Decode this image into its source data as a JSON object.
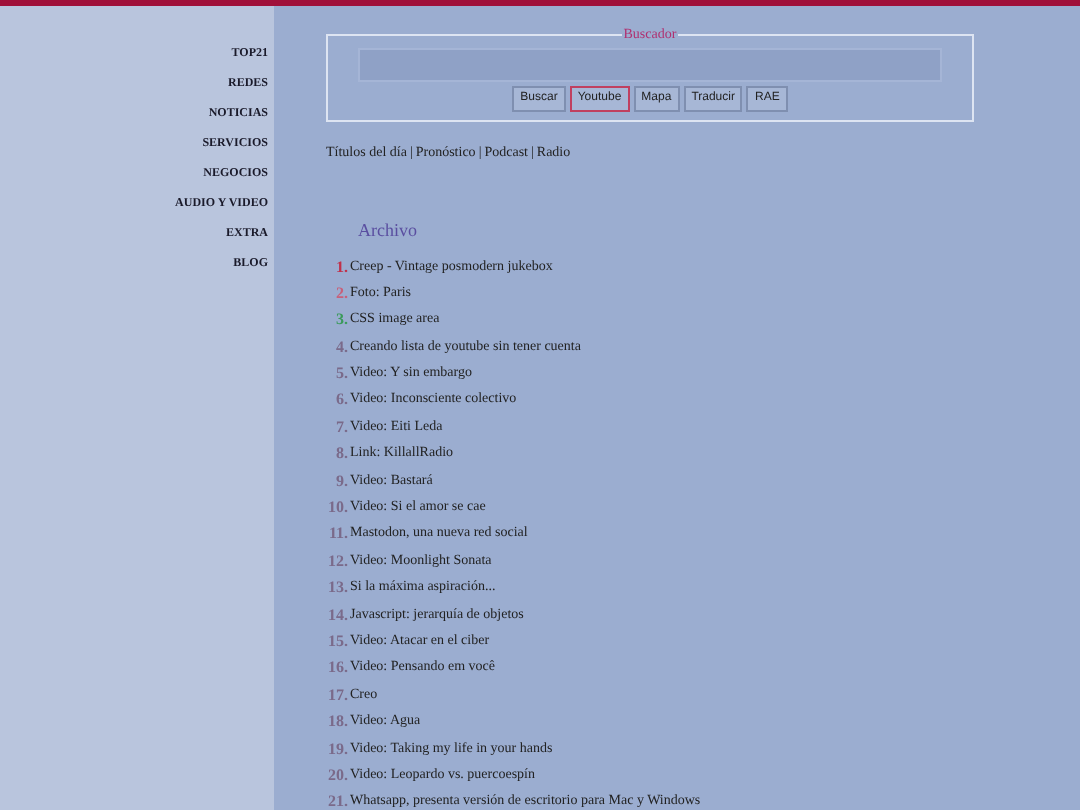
{
  "sidebar": {
    "items": [
      "TOP21",
      "REDES",
      "NOTICIAS",
      "SERVICIOS",
      "NEGOCIOS",
      "AUDIO Y VIDEO",
      "EXTRA",
      "BLOG"
    ]
  },
  "search": {
    "legend": "Buscador",
    "buttons": [
      {
        "label": "Buscar",
        "selected": false
      },
      {
        "label": "Youtube",
        "selected": true
      },
      {
        "label": "Mapa",
        "selected": false
      },
      {
        "label": "Traducir",
        "selected": false
      },
      {
        "label": "RAE",
        "selected": false
      }
    ]
  },
  "links": {
    "separator": "|",
    "items": [
      "Títulos del día",
      "Pronóstico",
      "Podcast",
      "Radio"
    ]
  },
  "archive": {
    "title": "Archivo",
    "items": [
      {
        "number": "1.",
        "text": "Creep - Vintage posmodern jukebox",
        "color": "#c0304a"
      },
      {
        "number": "2.",
        "text": "Foto: Paris",
        "color": "#c8607a"
      },
      {
        "number": "3.",
        "text": "CSS image area",
        "color": "#3a9a5a"
      },
      {
        "number": "4.",
        "text": "Creando lista de youtube sin tener cuenta",
        "color": "#7a6a8a"
      },
      {
        "number": "5.",
        "text": "Video: Y sin embargo",
        "color": "#7a6a8a"
      },
      {
        "number": "6.",
        "text": "Video: Inconsciente colectivo",
        "color": "#7a6a8a"
      },
      {
        "number": "7.",
        "text": "Video: Eiti Leda",
        "color": "#7a6a8a"
      },
      {
        "number": "8.",
        "text": "Link: KillallRadio",
        "color": "#7a6a8a"
      },
      {
        "number": "9.",
        "text": "Video: Bastará",
        "color": "#7a6a8a"
      },
      {
        "number": "10.",
        "text": "Video: Si el amor se cae",
        "color": "#7a6a8a"
      },
      {
        "number": "11.",
        "text": "Mastodon, una nueva red social",
        "color": "#7a6a8a"
      },
      {
        "number": "12.",
        "text": "Video: Moonlight Sonata",
        "color": "#7a6a8a"
      },
      {
        "number": "13.",
        "text": "Si la máxima aspiración...",
        "color": "#7a6a8a"
      },
      {
        "number": "14.",
        "text": "Javascript: jerarquía de objetos",
        "color": "#7a6a8a"
      },
      {
        "number": "15.",
        "text": "Video: Atacar en el ciber",
        "color": "#7a6a8a"
      },
      {
        "number": "16.",
        "text": "Video: Pensando em você",
        "color": "#7a6a8a"
      },
      {
        "number": "17.",
        "text": "Creo",
        "color": "#7a6a8a"
      },
      {
        "number": "18.",
        "text": "Video: Agua",
        "color": "#7a6a8a"
      },
      {
        "number": "19.",
        "text": "Video: Taking my life in your hands",
        "color": "#7a6a8a"
      },
      {
        "number": "20.",
        "text": "Video: Leopardo vs. puercoespín",
        "color": "#7a6a8a"
      },
      {
        "number": "21.",
        "text": "Whatsapp, presenta versión de escritorio para Mac y Windows",
        "color": "#7a6a8a"
      }
    ]
  }
}
